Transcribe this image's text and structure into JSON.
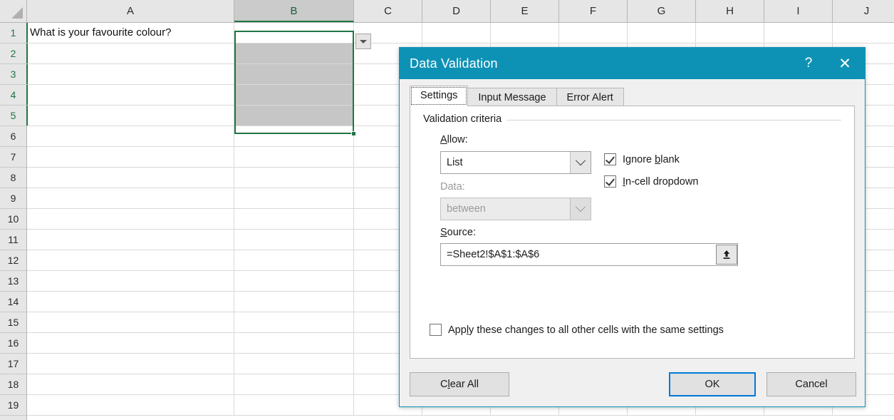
{
  "spreadsheet": {
    "columns": [
      "A",
      "B",
      "C",
      "D",
      "E",
      "F",
      "G",
      "H",
      "I",
      "J"
    ],
    "rows": [
      "1",
      "2",
      "3",
      "4",
      "5",
      "6",
      "7",
      "8",
      "9",
      "10",
      "11",
      "12",
      "13",
      "14",
      "15",
      "16",
      "17",
      "18",
      "19"
    ],
    "cells": {
      "A1": "What is your favourite colour?",
      "B1": ""
    },
    "selected_range": "B1:B5",
    "active_cell": "B1",
    "selection_color": "#217346",
    "shaded_cell_color": "#c6c6c6",
    "incell_dropdown_icon": "caret-down-icon",
    "select_all_icon": "select-all-triangle-icon"
  },
  "dialog": {
    "title": "Data Validation",
    "help_icon": "question-mark-icon",
    "help_label": "?",
    "close_icon": "close-icon",
    "close_label": "✕",
    "titlebar_color": "#0d92b5",
    "tabs": [
      {
        "label": "Settings",
        "active": true
      },
      {
        "label": "Input Message",
        "active": false
      },
      {
        "label": "Error Alert",
        "active": false
      }
    ],
    "settings": {
      "group_title": "Validation criteria",
      "allow": {
        "label": "Allow:",
        "accel": "A",
        "value": "List",
        "disabled": false,
        "arrow_icon": "chevron-down-icon"
      },
      "data": {
        "label": "Data:",
        "accel": "D",
        "value": "between",
        "disabled": true,
        "arrow_icon": "chevron-down-icon"
      },
      "source": {
        "label": "Source:",
        "accel": "S",
        "value": "=Sheet2!$A$1:$A$6",
        "picker_icon": "range-selector-icon"
      },
      "ignore_blank": {
        "label_pre": "Ignore ",
        "label_accel": "b",
        "label_post": "lank",
        "checked": true
      },
      "in_cell_dropdown": {
        "label_pre": "",
        "label_accel": "I",
        "label_post": "n-cell dropdown",
        "checked": true
      },
      "apply_all": {
        "label_pre": "App",
        "label_accel": "l",
        "label_post": "y these changes to all other cells with the same settings",
        "checked": false
      }
    },
    "buttons": {
      "clear_all_pre": "C",
      "clear_all_accel": "l",
      "clear_all_post": "ear All",
      "ok": "OK",
      "cancel": "Cancel",
      "focus_color": "#0078d7"
    }
  }
}
